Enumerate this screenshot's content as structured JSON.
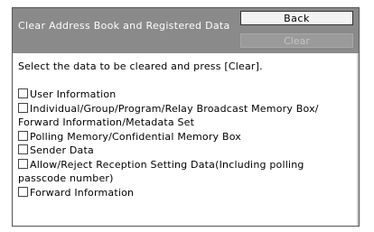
{
  "header": {
    "title": "Clear Address Book and Registered Data",
    "back_label": "Back",
    "clear_label": "Clear"
  },
  "instruction": "Select the data to be cleared and press [Clear].",
  "options": [
    {
      "label": "User Information",
      "checked": false
    },
    {
      "label": "Individual/Group/Program/Relay Broadcast Memory Box/ Forward Information/Metadata Set",
      "checked": false
    },
    {
      "label": "Polling Memory/Confidential Memory Box",
      "checked": false
    },
    {
      "label": "Sender Data",
      "checked": false
    },
    {
      "label": "Allow/Reject Reception Setting Data(Including polling passcode number)",
      "checked": false
    },
    {
      "label": "Forward Information",
      "checked": false
    }
  ]
}
